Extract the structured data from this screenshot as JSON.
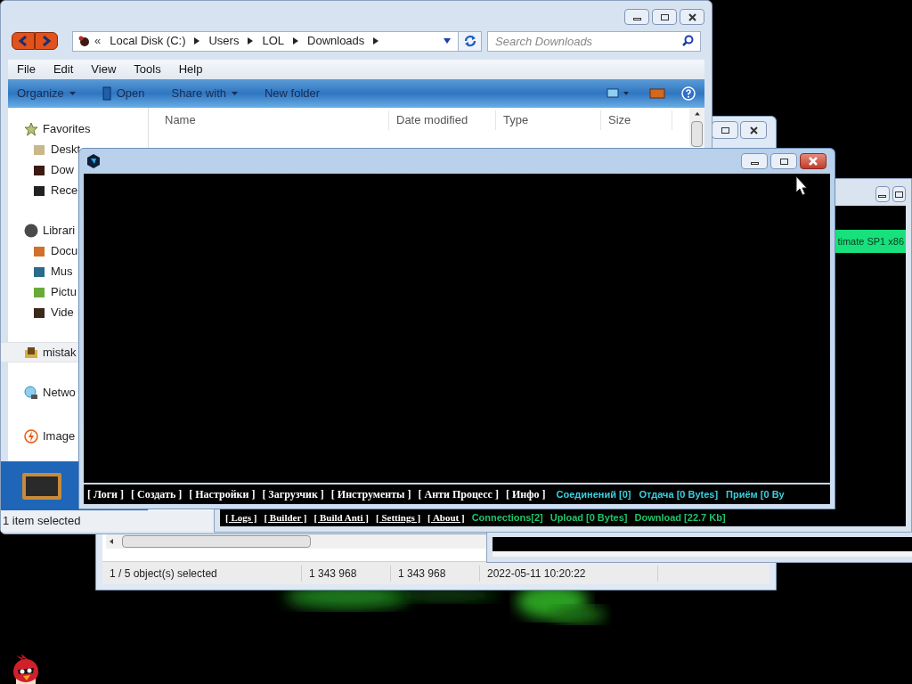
{
  "explorer": {
    "address_overflow": "«",
    "address": [
      "Local Disk (C:)",
      "Users",
      "LOL",
      "Downloads"
    ],
    "search": {
      "placeholder": "Search Downloads"
    },
    "menu": [
      "File",
      "Edit",
      "View",
      "Tools",
      "Help"
    ],
    "toolbar": [
      {
        "label": "Organize",
        "kind": "dropdown"
      },
      {
        "label": "Open",
        "kind": "icon"
      },
      {
        "label": "Share with",
        "kind": "dropdown"
      },
      {
        "label": "New folder",
        "kind": "plain"
      }
    ],
    "nav": [
      {
        "label": "Favorites",
        "selected": false,
        "children": [
          "Deskt",
          "Dow",
          "Rece"
        ]
      },
      {
        "label": "Librari",
        "selected": false,
        "children": [
          "Docu",
          "Mus",
          "Pictu",
          "Vide"
        ]
      },
      {
        "label": "mistak",
        "selected": true
      },
      {
        "label": "Netwo",
        "selected": false
      },
      {
        "label": "Image",
        "selected": false
      }
    ],
    "columns": [
      "Name",
      "Date modified",
      "Type",
      "Size"
    ],
    "status": "1 item selected"
  },
  "file_manager": {
    "status": [
      "1 / 5 object(s) selected",
      "1 343 968",
      "1 343 968",
      "2022-05-11 10:20:22"
    ]
  },
  "console_window": {
    "banner": "timate SP1 x86",
    "menu": [
      "[ Logs ]",
      "[ Builder ]",
      "[ Build Anti ]",
      "[ Settings ]",
      "[ About ]"
    ],
    "stats": [
      "Connections[2]",
      "Upload [0 Bytes]",
      "Download [22.7 Kb]"
    ]
  },
  "main_window": {
    "menu": [
      "[ Логи ]",
      "[ Создать ]",
      "[ Настройки ]",
      "[ Загрузчик ]",
      "[ Инструменты ]",
      "[ Анти Процесс ]",
      "[ Инфо ]"
    ],
    "stats": [
      "Соединений [0]",
      "Отдача [0 Bytes]",
      "Приём [0 By"
    ]
  }
}
